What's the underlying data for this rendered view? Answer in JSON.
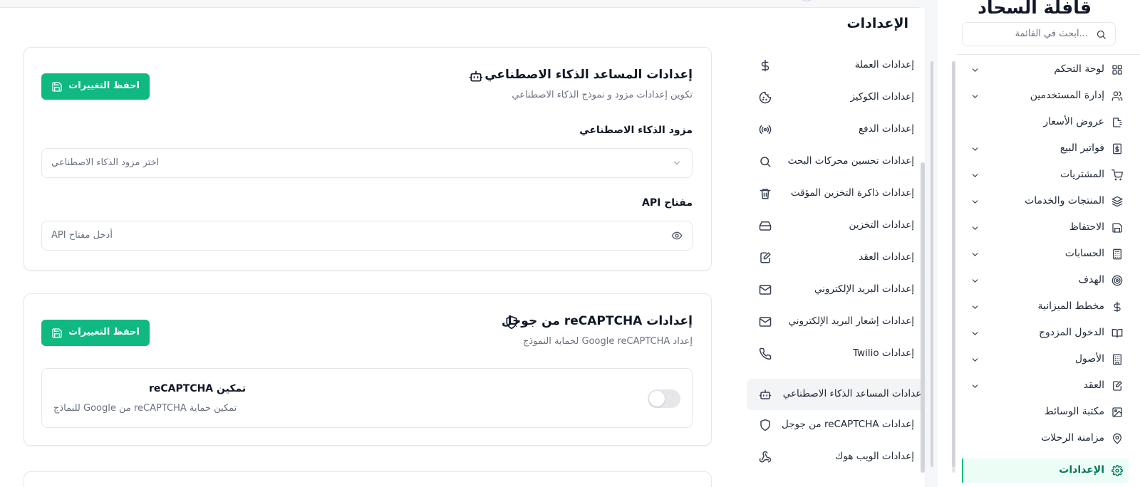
{
  "app": {
    "title": "قافلة السحاد"
  },
  "search": {
    "placeholder": "ابحث في القائمة..."
  },
  "sidebar": {
    "items": [
      {
        "label": "لوحة التحكم",
        "icon": "dashboard-icon",
        "expandable": true
      },
      {
        "label": "إدارة المستخدمين",
        "icon": "users-icon",
        "expandable": true
      },
      {
        "label": "عروض الأسعار",
        "icon": "quote-icon",
        "expandable": false
      },
      {
        "label": "فواتير البيع",
        "icon": "invoice-icon",
        "expandable": true
      },
      {
        "label": "المشتريات",
        "icon": "cart-icon",
        "expandable": true
      },
      {
        "label": "المنتجات والخدمات",
        "icon": "layers-icon",
        "expandable": true
      },
      {
        "label": "الاحتفاظ",
        "icon": "save-icon",
        "expandable": true
      },
      {
        "label": "الحسابات",
        "icon": "calculator-icon",
        "expandable": true
      },
      {
        "label": "الهدف",
        "icon": "target-icon",
        "expandable": true
      },
      {
        "label": "مخطط الميزانية",
        "icon": "dollar-icon",
        "expandable": true
      },
      {
        "label": "الدخول المزدوج",
        "icon": "book-icon",
        "expandable": true
      },
      {
        "label": "الأصول",
        "icon": "building-icon",
        "expandable": true
      },
      {
        "label": "العقد",
        "icon": "contract-icon",
        "expandable": true
      },
      {
        "label": "مكتبة الوسائط",
        "icon": "image-icon",
        "expandable": false
      },
      {
        "label": "مزامنة الرحلات",
        "icon": "map-pin-icon",
        "expandable": false
      },
      {
        "label": "الإعدادات",
        "icon": "gear-icon",
        "expandable": false,
        "active": true
      }
    ]
  },
  "page": {
    "title": "الإعدادات"
  },
  "settings_menu": {
    "items": [
      {
        "label": "إعدادات العملة",
        "icon": "dollar-icon"
      },
      {
        "label": "إعدادات الكوكيز",
        "icon": "cookie-icon"
      },
      {
        "label": "إعدادات الدفع",
        "icon": "broadcast-icon"
      },
      {
        "label": "إعدادات تحسين محركات البحث",
        "icon": "search-icon"
      },
      {
        "label": "إعدادات ذاكرة التخزين المؤقت",
        "icon": "trash-icon"
      },
      {
        "label": "إعدادات التخزين",
        "icon": "hard-drive-icon"
      },
      {
        "label": "إعدادات العقد",
        "icon": "contract-icon"
      },
      {
        "label": "إعدادات البريد الإلكتروني",
        "icon": "mail-icon"
      },
      {
        "label": "إعدادات إشعار البريد الإلكتروني",
        "icon": "mail-icon"
      },
      {
        "label": "Twilio إعدادات",
        "icon": "phone-icon"
      },
      {
        "label": "إعدادات المساعد الذكاء الاصطناعي",
        "icon": "bot-icon",
        "active": true
      },
      {
        "label": "من جوجل reCAPTCHA إعدادات",
        "icon": "shield-icon"
      },
      {
        "label": "إعدادات الويب هوك",
        "icon": "webhook-icon"
      }
    ]
  },
  "ai_card": {
    "title": "إعدادات المساعد الذكاء الاصطناعي",
    "subtitle": "تكوين إعدادات مزود و نموذج الذكاء الاصطناعي",
    "save_label": "احفظ التغييرات",
    "provider_label": "مزود الذكاء الاصطناعي",
    "provider_placeholder": "اختر مزود الذكاء الاصطناعي",
    "api_key_label": "API مفتاح",
    "api_key_placeholder": "API أدخل مفتاح"
  },
  "recaptcha_card": {
    "title": "من جوجل reCAPTCHA إعدادات",
    "subtitle": "لحماية النموذج Google reCAPTCHA إعداد",
    "save_label": "احفظ التغييرات",
    "toggle_title": "reCAPTCHA تمكين",
    "toggle_desc": "للنماذج Google من reCAPTCHA تمكين حماية",
    "enabled": false
  },
  "colors": {
    "accent": "#10b981",
    "accent_bg": "#ecfdf5"
  }
}
